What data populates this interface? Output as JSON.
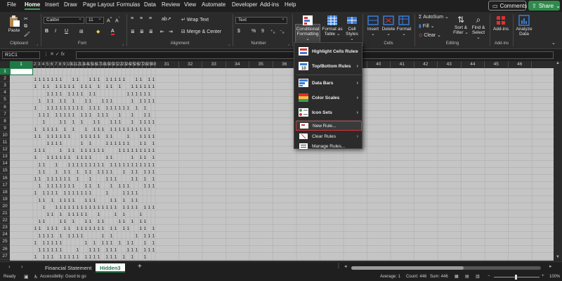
{
  "menu": {
    "tabs": [
      "File",
      "Home",
      "Insert",
      "Draw",
      "Page Layout",
      "Formulas",
      "Data",
      "Review",
      "View",
      "Automate",
      "Developer",
      "Add-ins",
      "Help"
    ],
    "active": "Home",
    "comments_label": "Comments",
    "share_label": "Share"
  },
  "ribbon": {
    "clipboard": {
      "paste": "Paste",
      "label": "Clipboard"
    },
    "font": {
      "name": "Calibri",
      "size": "11",
      "label": "Font"
    },
    "alignment": {
      "wrap": "Wrap Text",
      "merge": "Merge & Center",
      "label": "Alignment"
    },
    "number": {
      "format": "Text",
      "currency": "$",
      "percent": "%",
      "comma": "9",
      "label": "Number"
    },
    "styles": {
      "cond": "Conditional",
      "cond2": "Formatting",
      "table": "Format as",
      "table2": "Table",
      "cell": "Cell",
      "cell2": "Styles"
    },
    "cells": {
      "insert": "Insert",
      "delete": "Delete",
      "format": "Format",
      "label": "Cells"
    },
    "editing": {
      "autosum": "AutoSum",
      "fill": "Fill",
      "clear": "Clear",
      "sort": "Sort &",
      "sort2": "Filter",
      "find": "Find &",
      "find2": "Select",
      "label": "Editing"
    },
    "addins": {
      "addins": "Add-ins",
      "label": "Add-ins"
    },
    "analyze": {
      "line1": "Analyze",
      "line2": "Data"
    }
  },
  "formula_bar": {
    "name_box": "R1C1",
    "fx": "fx",
    "value": ""
  },
  "columns": [
    "1",
    "2",
    "3",
    "4",
    "5",
    "6",
    "7",
    "8",
    "9",
    "10",
    "11",
    "12",
    "13",
    "14",
    "15",
    "16",
    "17",
    "18",
    "19",
    "20",
    "21",
    "22",
    "23",
    "24",
    "25",
    "26",
    "27",
    "28",
    "29",
    "30",
    "31",
    "32",
    "33",
    "34",
    "35",
    "36",
    "37",
    "38",
    "39",
    "40",
    "41",
    "42",
    "43",
    "44",
    "45",
    "46"
  ],
  "rows": [
    "1",
    "2",
    "3",
    "4",
    "5",
    "6",
    "7",
    "8",
    "9",
    "10",
    "11",
    "12",
    "13",
    "14",
    "15",
    "16",
    "17",
    "18",
    "19",
    "20",
    "21",
    "22",
    "23",
    "24",
    "25",
    "26",
    "27"
  ],
  "cell_value": "1",
  "dropdown": {
    "highlight": "Highlight Cells Rules",
    "topbottom": "Top/Bottom Rules",
    "databars": "Data Bars",
    "colorscales": "Color Scales",
    "iconsets": "Icon Sets",
    "newrule": "New Rule...",
    "clearrules": "Clear Rules",
    "managerules": "Manage Rules..."
  },
  "sheets": [
    "Financial Statement",
    "Hidden3"
  ],
  "active_sheet": "Hidden3",
  "status": {
    "ready": "Ready",
    "accessibility": "Accessibility: Good to go",
    "average": "Average: 1",
    "count": "Count: 446",
    "sum": "Sum: 446",
    "zoom": "100%"
  }
}
